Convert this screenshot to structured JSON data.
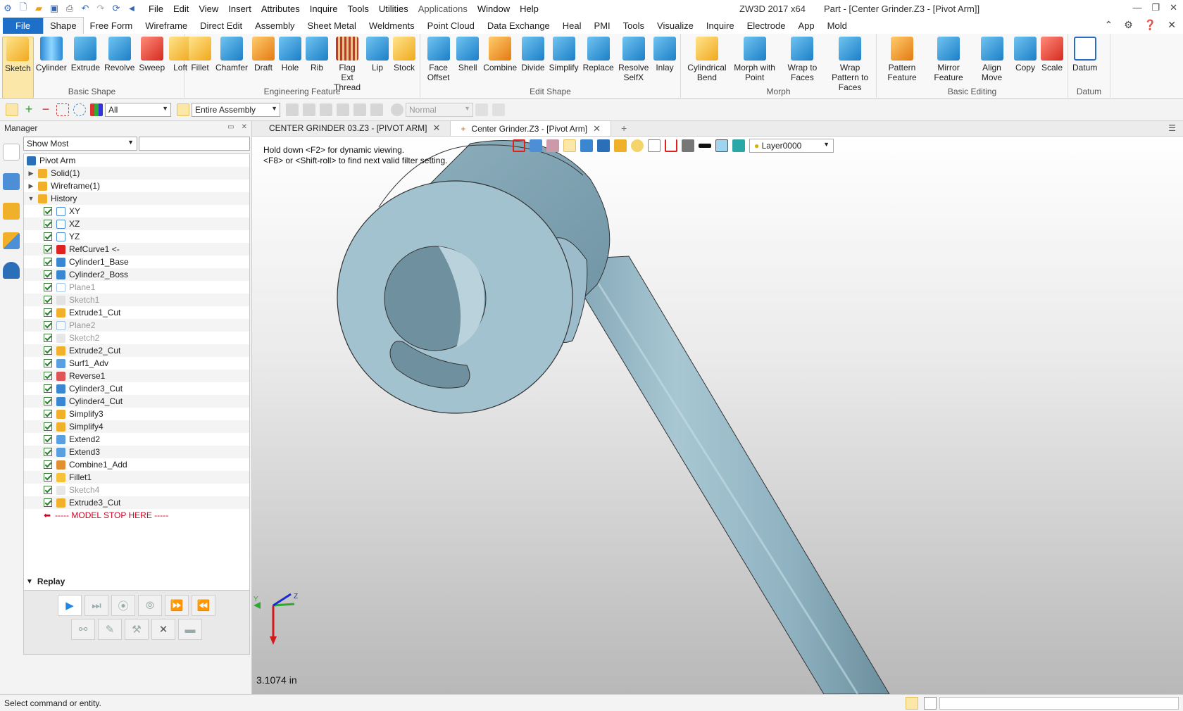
{
  "app": {
    "name": "ZW3D 2017  x64",
    "document": "Part - [Center Grinder.Z3 - [Pivot Arm]]"
  },
  "menu": [
    "File",
    "Edit",
    "View",
    "Insert",
    "Attributes",
    "Inquire",
    "Tools",
    "Utilities",
    "Applications",
    "Window",
    "Help"
  ],
  "ribbon_tabs": [
    "File",
    "Shape",
    "Free Form",
    "Wireframe",
    "Direct Edit",
    "Assembly",
    "Sheet Metal",
    "Weldments",
    "Point Cloud",
    "Data Exchange",
    "Heal",
    "PMI",
    "Tools",
    "Visualize",
    "Inquire",
    "Electrode",
    "App",
    "Mold"
  ],
  "ribbon_groups": [
    {
      "label": "Basic Shape",
      "buttons": [
        {
          "label": "Sketch",
          "icon": "sketch-icon",
          "color": "yellow"
        },
        {
          "label": "Cylinder",
          "icon": "cylinder-icon",
          "color": "cyl"
        },
        {
          "label": "Extrude",
          "icon": "extrude-icon",
          "color": "blue"
        },
        {
          "label": "Revolve",
          "icon": "revolve-icon",
          "color": "blue"
        },
        {
          "label": "Sweep",
          "icon": "sweep-icon",
          "color": "red"
        },
        {
          "label": "Loft",
          "icon": "loft-icon",
          "color": "yellow"
        }
      ]
    },
    {
      "label": "Engineering Feature",
      "buttons": [
        {
          "label": "Fillet",
          "icon": "fillet-icon",
          "color": "yellow"
        },
        {
          "label": "Chamfer",
          "icon": "chamfer-icon",
          "color": "blue"
        },
        {
          "label": "Draft",
          "icon": "draft-icon",
          "color": "orange"
        },
        {
          "label": "Hole",
          "icon": "hole-icon",
          "color": "blue"
        },
        {
          "label": "Rib",
          "icon": "rib-icon",
          "color": "blue"
        },
        {
          "label": "Flag Ext Thread",
          "icon": "thread-icon",
          "color": "stripe"
        },
        {
          "label": "Lip",
          "icon": "lip-icon",
          "color": "blue"
        },
        {
          "label": "Stock",
          "icon": "stock-icon",
          "color": "yellow"
        }
      ]
    },
    {
      "label": "Edit Shape",
      "buttons": [
        {
          "label": "Face Offset",
          "icon": "face-offset-icon",
          "color": "blue"
        },
        {
          "label": "Shell",
          "icon": "shell-icon",
          "color": "blue"
        },
        {
          "label": "Combine",
          "icon": "combine-icon",
          "color": "orange"
        },
        {
          "label": "Divide",
          "icon": "divide-icon",
          "color": "blue"
        },
        {
          "label": "Simplify",
          "icon": "simplify-icon",
          "color": "blue"
        },
        {
          "label": "Replace",
          "icon": "replace-icon",
          "color": "blue"
        },
        {
          "label": "Resolve SelfX",
          "icon": "resolve-icon",
          "color": "blue"
        },
        {
          "label": "Inlay",
          "icon": "inlay-icon",
          "color": "blue"
        }
      ]
    },
    {
      "label": "Morph",
      "buttons": [
        {
          "label": "Cylindrical Bend",
          "icon": "cyl-bend-icon",
          "color": "yellow"
        },
        {
          "label": "Morph with Point",
          "icon": "morph-point-icon",
          "color": "blue"
        },
        {
          "label": "Wrap to Faces",
          "icon": "wrap-faces-icon",
          "color": "blue"
        },
        {
          "label": "Wrap Pattern to Faces",
          "icon": "wrap-pattern-icon",
          "color": "blue"
        }
      ]
    },
    {
      "label": "Basic Editing",
      "buttons": [
        {
          "label": "Pattern Feature",
          "icon": "pattern-icon",
          "color": "orange"
        },
        {
          "label": "Mirror Feature",
          "icon": "mirror-icon",
          "color": "blue"
        },
        {
          "label": "Align Move",
          "icon": "align-move-icon",
          "color": "blue"
        },
        {
          "label": "Copy",
          "icon": "copy-icon",
          "color": "blue"
        },
        {
          "label": "Scale",
          "icon": "scale-icon",
          "color": "red"
        }
      ]
    },
    {
      "label": "Datum",
      "buttons": [
        {
          "label": "Datum",
          "icon": "datum-icon",
          "color": "datum"
        }
      ]
    }
  ],
  "cmdbar": {
    "filter": "All",
    "assembly": "Entire Assembly",
    "mode": "Normal"
  },
  "manager": {
    "title": "Manager",
    "show": "Show Most"
  },
  "tree": [
    {
      "label": "Pivot Arm",
      "level": 0,
      "type": "part"
    },
    {
      "label": "Solid(1)",
      "level": 1,
      "type": "folder",
      "toggle": "▶"
    },
    {
      "label": "Wireframe(1)",
      "level": 1,
      "type": "folder",
      "toggle": "▶"
    },
    {
      "label": "History",
      "level": 1,
      "type": "folder",
      "toggle": "▼"
    },
    {
      "label": "XY",
      "level": 2,
      "type": "plane",
      "check": true
    },
    {
      "label": "XZ",
      "level": 2,
      "type": "plane",
      "check": true
    },
    {
      "label": "YZ",
      "level": 2,
      "type": "plane",
      "check": true
    },
    {
      "label": "RefCurve1 <-",
      "level": 2,
      "type": "ref",
      "check": true
    },
    {
      "label": "Cylinder1_Base",
      "level": 2,
      "type": "cyl",
      "check": true
    },
    {
      "label": "Cylinder2_Boss",
      "level": 2,
      "type": "cyl",
      "check": true
    },
    {
      "label": "Plane1",
      "level": 2,
      "type": "plane",
      "check": true,
      "dim": true
    },
    {
      "label": "Sketch1",
      "level": 2,
      "type": "sketch",
      "check": true,
      "dim": true
    },
    {
      "label": "Extrude1_Cut",
      "level": 2,
      "type": "extrude",
      "check": true
    },
    {
      "label": "Plane2",
      "level": 2,
      "type": "plane",
      "check": true,
      "dim": true
    },
    {
      "label": "Sketch2",
      "level": 2,
      "type": "sketch",
      "check": true,
      "dim": true
    },
    {
      "label": "Extrude2_Cut",
      "level": 2,
      "type": "extrude",
      "check": true
    },
    {
      "label": "Surf1_Adv",
      "level": 2,
      "type": "surf",
      "check": true
    },
    {
      "label": "Reverse1",
      "level": 2,
      "type": "reverse",
      "check": true
    },
    {
      "label": "Cylinder3_Cut",
      "level": 2,
      "type": "cyl",
      "check": true
    },
    {
      "label": "Cylinder4_Cut",
      "level": 2,
      "type": "cyl",
      "check": true
    },
    {
      "label": "Simplify3",
      "level": 2,
      "type": "extrude",
      "check": true
    },
    {
      "label": "Simplify4",
      "level": 2,
      "type": "extrude",
      "check": true
    },
    {
      "label": "Extend2",
      "level": 2,
      "type": "surf",
      "check": true
    },
    {
      "label": "Extend3",
      "level": 2,
      "type": "surf",
      "check": true
    },
    {
      "label": "Combine1_Add",
      "level": 2,
      "type": "combine",
      "check": true
    },
    {
      "label": "Fillet1",
      "level": 2,
      "type": "fillet",
      "check": true
    },
    {
      "label": "Sketch4",
      "level": 2,
      "type": "sketch",
      "check": true,
      "dim": true
    },
    {
      "label": "Extrude3_Cut",
      "level": 2,
      "type": "extrude",
      "check": true
    },
    {
      "label": "----- MODEL STOP HERE -----",
      "level": 2,
      "type": "stop"
    }
  ],
  "replay": {
    "title": "Replay"
  },
  "doc_tabs": [
    {
      "label": "CENTER GRINDER 03.Z3 - [PIVOT ARM]",
      "active": false
    },
    {
      "label": "Center Grinder.Z3 - [Pivot Arm]",
      "active": true
    }
  ],
  "viewport": {
    "hint1": "Hold down <F2> for dynamic viewing.",
    "hint2": "<F8> or <Shift-roll> to find next valid filter setting.",
    "layer": "Layer0000",
    "scale": "3.1074 in"
  },
  "status": {
    "message": "Select command or entity."
  },
  "colors": {
    "accent": "#1e6fc8",
    "part": "#9fbfcc",
    "part_dark": "#6e909f",
    "stop": "#d00020",
    "selected": "#fbe7a7"
  }
}
